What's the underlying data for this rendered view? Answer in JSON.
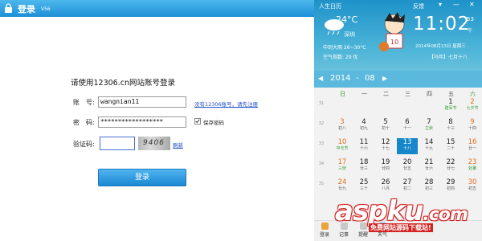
{
  "login": {
    "title": "登录",
    "version": "V56",
    "heading": "请使用12306.cn网站账号登录",
    "account_label": "账　号:",
    "account_value": "wangnian11",
    "register_link": "没有12306账号，请先注册",
    "password_label": "密　码:",
    "password_value": "******************",
    "save_password_label": "保存密码",
    "save_password_checked": true,
    "captcha_label": "验证码:",
    "captcha_value": "",
    "captcha_image_text": "9406",
    "refresh_link": "刷新",
    "login_button": "登录"
  },
  "calendar": {
    "app_title": "人生日历",
    "feedback": "反馈",
    "temperature": "24°C",
    "city": "深圳",
    "time": "11:02",
    "seconds": "53",
    "ampm": "午",
    "weather": "中到大雨 26~30°C",
    "aqi": "空气指数: 29 优",
    "date_line": "2014年08月13日 星期三",
    "lunar_line": "【马年】七月十八",
    "year": "2014",
    "month": "08",
    "weekdays": [
      "日",
      "一",
      "二",
      "三",
      "四",
      "五",
      "六"
    ],
    "week_numbers": [
      "31",
      "32",
      "33",
      "34",
      "35"
    ],
    "rows": [
      [
        {
          "n": "",
          "s": ""
        },
        {
          "n": "",
          "s": ""
        },
        {
          "n": "",
          "s": ""
        },
        {
          "n": "",
          "s": ""
        },
        {
          "n": "",
          "s": ""
        },
        {
          "n": "1",
          "s": "建军节"
        },
        {
          "n": "2",
          "s": "七夕节"
        }
      ],
      [
        {
          "n": "3",
          "s": "初八"
        },
        {
          "n": "4",
          "s": "初九"
        },
        {
          "n": "5",
          "s": "初十"
        },
        {
          "n": "6",
          "s": "十一"
        },
        {
          "n": "7",
          "s": "立秋"
        },
        {
          "n": "8",
          "s": "十三"
        },
        {
          "n": "9",
          "s": "十四"
        }
      ],
      [
        {
          "n": "10",
          "s": "中元节"
        },
        {
          "n": "11",
          "s": "十六"
        },
        {
          "n": "12",
          "s": "十七"
        },
        {
          "n": "13",
          "s": "十八"
        },
        {
          "n": "14",
          "s": "十九"
        },
        {
          "n": "15",
          "s": "二十"
        },
        {
          "n": "16",
          "s": "廿一"
        }
      ],
      [
        {
          "n": "17",
          "s": "三伏"
        },
        {
          "n": "18",
          "s": "廿三"
        },
        {
          "n": "19",
          "s": "廿四"
        },
        {
          "n": "20",
          "s": "廿五"
        },
        {
          "n": "21",
          "s": "廿六"
        },
        {
          "n": "22",
          "s": "廿七"
        },
        {
          "n": "23",
          "s": "处暑"
        }
      ],
      [
        {
          "n": "24",
          "s": "廿九"
        },
        {
          "n": "25",
          "s": "三十"
        },
        {
          "n": "26",
          "s": "八月"
        },
        {
          "n": "27",
          "s": "初二"
        },
        {
          "n": "28",
          "s": "初三"
        },
        {
          "n": "29",
          "s": "初四"
        },
        {
          "n": "30",
          "s": "初五"
        }
      ]
    ],
    "bottom_tabs": [
      "登录",
      "记事",
      "提醒",
      "天气"
    ],
    "colors": {
      "header": "#1e92c9",
      "selected": "#1787c9",
      "weekend": "#2d9b2d",
      "festival": "#2d9b2d"
    }
  },
  "watermark": {
    "brand": "aspku",
    "domain": ".com",
    "tagline": "免费网站源码下载站!"
  }
}
